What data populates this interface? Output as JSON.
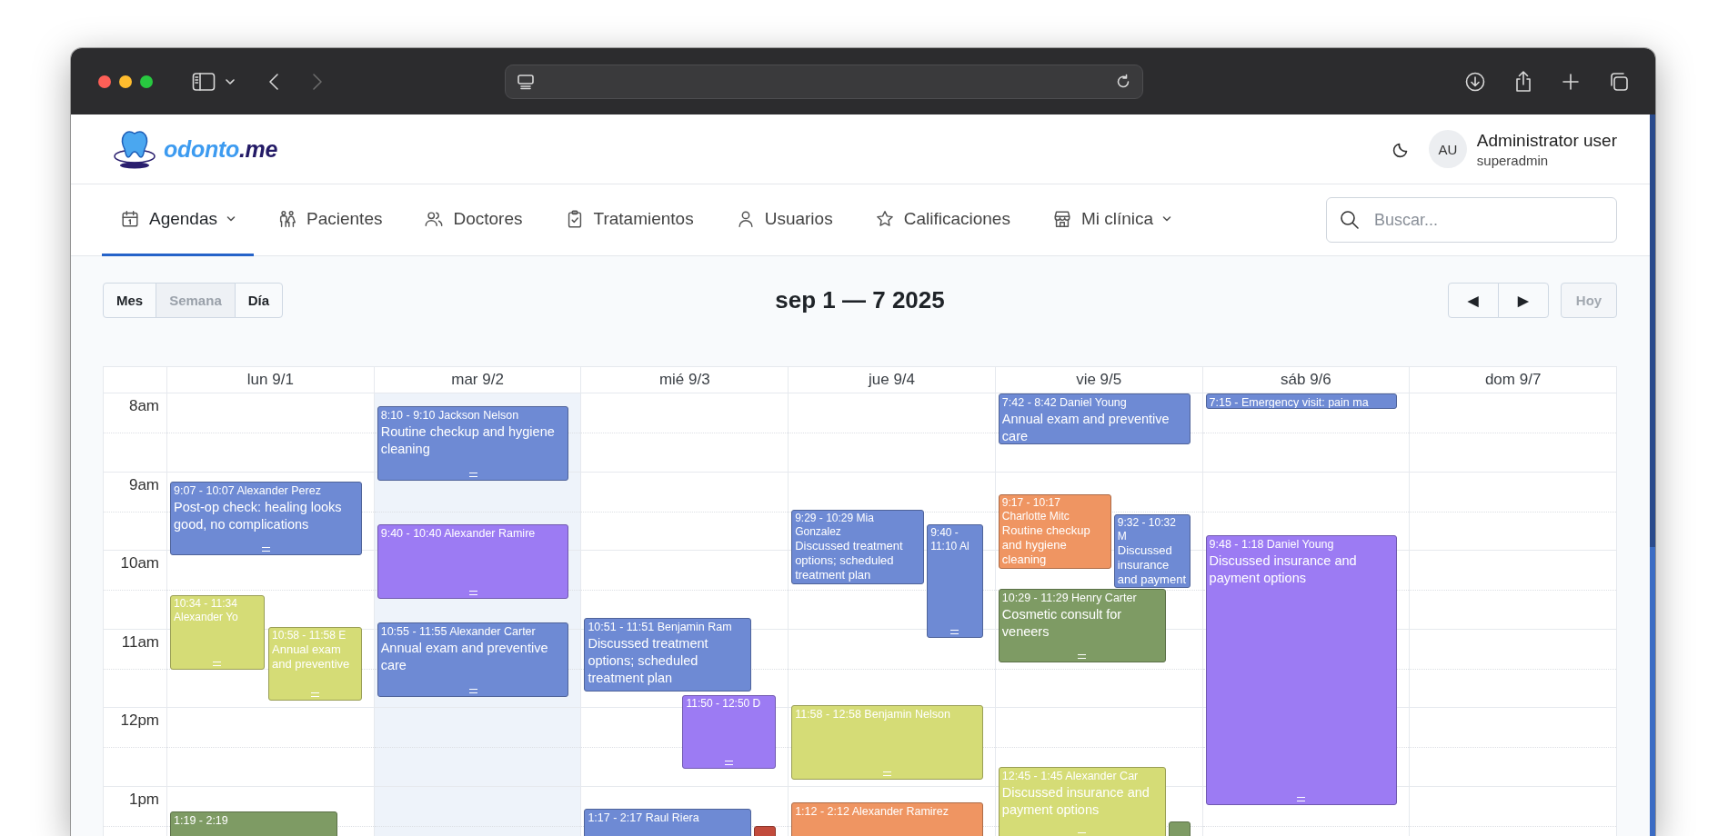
{
  "browser": {
    "back": {
      "disabled": false
    },
    "forward": {
      "disabled": true
    }
  },
  "app_header": {
    "logo": {
      "text": "odonto",
      "suffix": ".me"
    },
    "user": {
      "initials": "AU",
      "name": "Administrator user",
      "role": "superadmin"
    }
  },
  "nav": [
    {
      "label": "Agendas",
      "selected": true,
      "dropdown": true
    },
    {
      "label": "Pacientes",
      "selected": false,
      "dropdown": false
    },
    {
      "label": "Doctores",
      "selected": false,
      "dropdown": false
    },
    {
      "label": "Tratamientos",
      "selected": false,
      "dropdown": false
    },
    {
      "label": "Usuarios",
      "selected": false,
      "dropdown": false
    },
    {
      "label": "Calificaciones",
      "selected": false,
      "dropdown": false
    },
    {
      "label": "Mi clínica",
      "selected": false,
      "dropdown": true
    }
  ],
  "search": {
    "placeholder": "Buscar..."
  },
  "views": [
    {
      "label": "Mes",
      "selected": false
    },
    {
      "label": "Semana",
      "selected": true
    },
    {
      "label": "Día",
      "selected": false
    }
  ],
  "title": "sep 1 — 7 2025",
  "prev": "◀",
  "next": "▶",
  "today_button": {
    "label": "Hoy",
    "disabled": true
  },
  "calendar": {
    "hours": [
      "8am",
      "9am",
      "10am",
      "11am",
      "12pm",
      "1pm"
    ],
    "days": [
      {
        "label": "lun 9/1",
        "today": false,
        "events": [
          {
            "heading": "9:07 - 10:07 Alexander Perez",
            "description": "Post-op check: healing looks good, no complications",
            "color": "#6e8ad4"
          },
          {
            "heading": "10:34 - 11:34 Alexander Yo",
            "color": "#d5dc76"
          },
          {
            "heading": "10:58 - 11:58 E",
            "description": "Annual exam and preventive",
            "color": "#d5dc76"
          },
          {
            "heading": "1:19 - 2:19",
            "color": "#7e9b64"
          }
        ]
      },
      {
        "label": "mar 9/2",
        "today": true,
        "events": [
          {
            "heading": "8:10 - 9:10 Jackson Nelson",
            "description": "Routine checkup and hygiene cleaning",
            "color": "#6e8ad4"
          },
          {
            "heading": "9:40 - 10:40 Alexander Ramire",
            "color": "#9c7bf3"
          },
          {
            "heading": "10:55 - 11:55 Alexander Carter",
            "description": "Annual exam and preventive care",
            "color": "#6e8ad4"
          }
        ]
      },
      {
        "label": "mié 9/3",
        "today": false,
        "events": [
          {
            "heading": "10:51 - 11:51 Benjamin Ram",
            "description": "Discussed treatment options; scheduled treatment plan",
            "color": "#6e8ad4"
          },
          {
            "heading": "11:50 - 12:50 D",
            "color": "#9c7bf3"
          },
          {
            "heading": "1:17 - 2:17 Raul Riera",
            "color": "#6e8ad4"
          },
          {
            "color": "#c24b3c"
          }
        ]
      },
      {
        "label": "jue 9/4",
        "today": false,
        "events": [
          {
            "heading": "9:29 - 10:29 Mia Gonzalez",
            "description": "Discussed treatment options; scheduled treatment plan",
            "color": "#6e8ad4"
          },
          {
            "heading": "9:40 - 11:10 Al",
            "color": "#6e8ad4"
          },
          {
            "heading": "11:58 - 12:58 Benjamin Nelson",
            "color": "#d5dc76"
          },
          {
            "heading": "1:12 - 2:12 Alexander Ramirez",
            "color": "#ef9562"
          }
        ]
      },
      {
        "label": "vie 9/5",
        "today": false,
        "events": [
          {
            "heading": "7:42 - 8:42 Daniel Young",
            "description": "Annual exam and preventive care",
            "color": "#6e8ad4"
          },
          {
            "heading": "9:17 - 10:17 Charlotte Mitc",
            "description": "Routine checkup and hygiene cleaning",
            "color": "#ef9562"
          },
          {
            "heading": "9:32 - 10:32 M",
            "description": "Discussed insurance and payment",
            "color": "#6e8ad4"
          },
          {
            "heading": "10:29 - 11:29 Henry Carter",
            "description": "Cosmetic consult for veneers",
            "color": "#7e9b64"
          },
          {
            "heading": "12:45 - 1:45 Alexander Car",
            "description": "Discussed insurance and payment options",
            "color": "#d5dc76"
          },
          {
            "color": "#7e9b64"
          }
        ]
      },
      {
        "label": "sáb 9/6",
        "today": false,
        "events": [
          {
            "heading": "7:15 - Emergency visit: pain ma",
            "color": "#6e8ad4"
          },
          {
            "heading": "9:48 - 1:18 Daniel Young",
            "description": "Discussed insurance and payment options",
            "color": "#9c7bf3"
          }
        ]
      },
      {
        "label": "dom 9/7",
        "today": false
      }
    ]
  }
}
